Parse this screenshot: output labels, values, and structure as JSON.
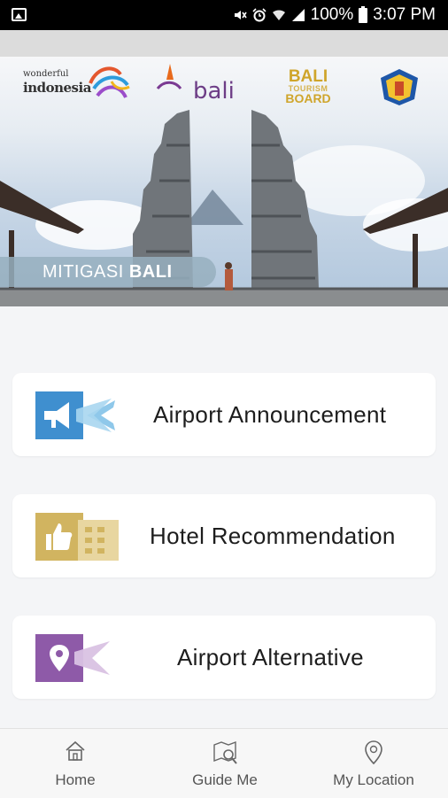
{
  "status_bar": {
    "battery": "100%",
    "time": "3:07 PM",
    "icons": [
      "image-icon",
      "mute-icon",
      "alarm-icon",
      "wifi-icon",
      "signal-icon",
      "battery-icon"
    ]
  },
  "banner": {
    "logo_wonderful": "wonderful",
    "logo_indonesia": "indonesia",
    "logo_bali": "bali",
    "logo_btb_line1": "BALI",
    "logo_btb_line2": "TOURISM",
    "logo_btb_line3": "BOARD",
    "title_prefix": "MITIGASI",
    "title_bold": "BALI"
  },
  "menu": {
    "items": [
      {
        "label": "Airport Announcement",
        "icon": "megaphone-plane-icon",
        "color": "#3f8fcf"
      },
      {
        "label": "Hotel Recommendation",
        "icon": "thumbs-up-building-icon",
        "color": "#d1b460"
      },
      {
        "label": "Airport Alternative",
        "icon": "location-plane-icon",
        "color": "#8e5aa8"
      }
    ]
  },
  "bottom_nav": {
    "home": "Home",
    "guide": "Guide Me",
    "location": "My Location"
  }
}
